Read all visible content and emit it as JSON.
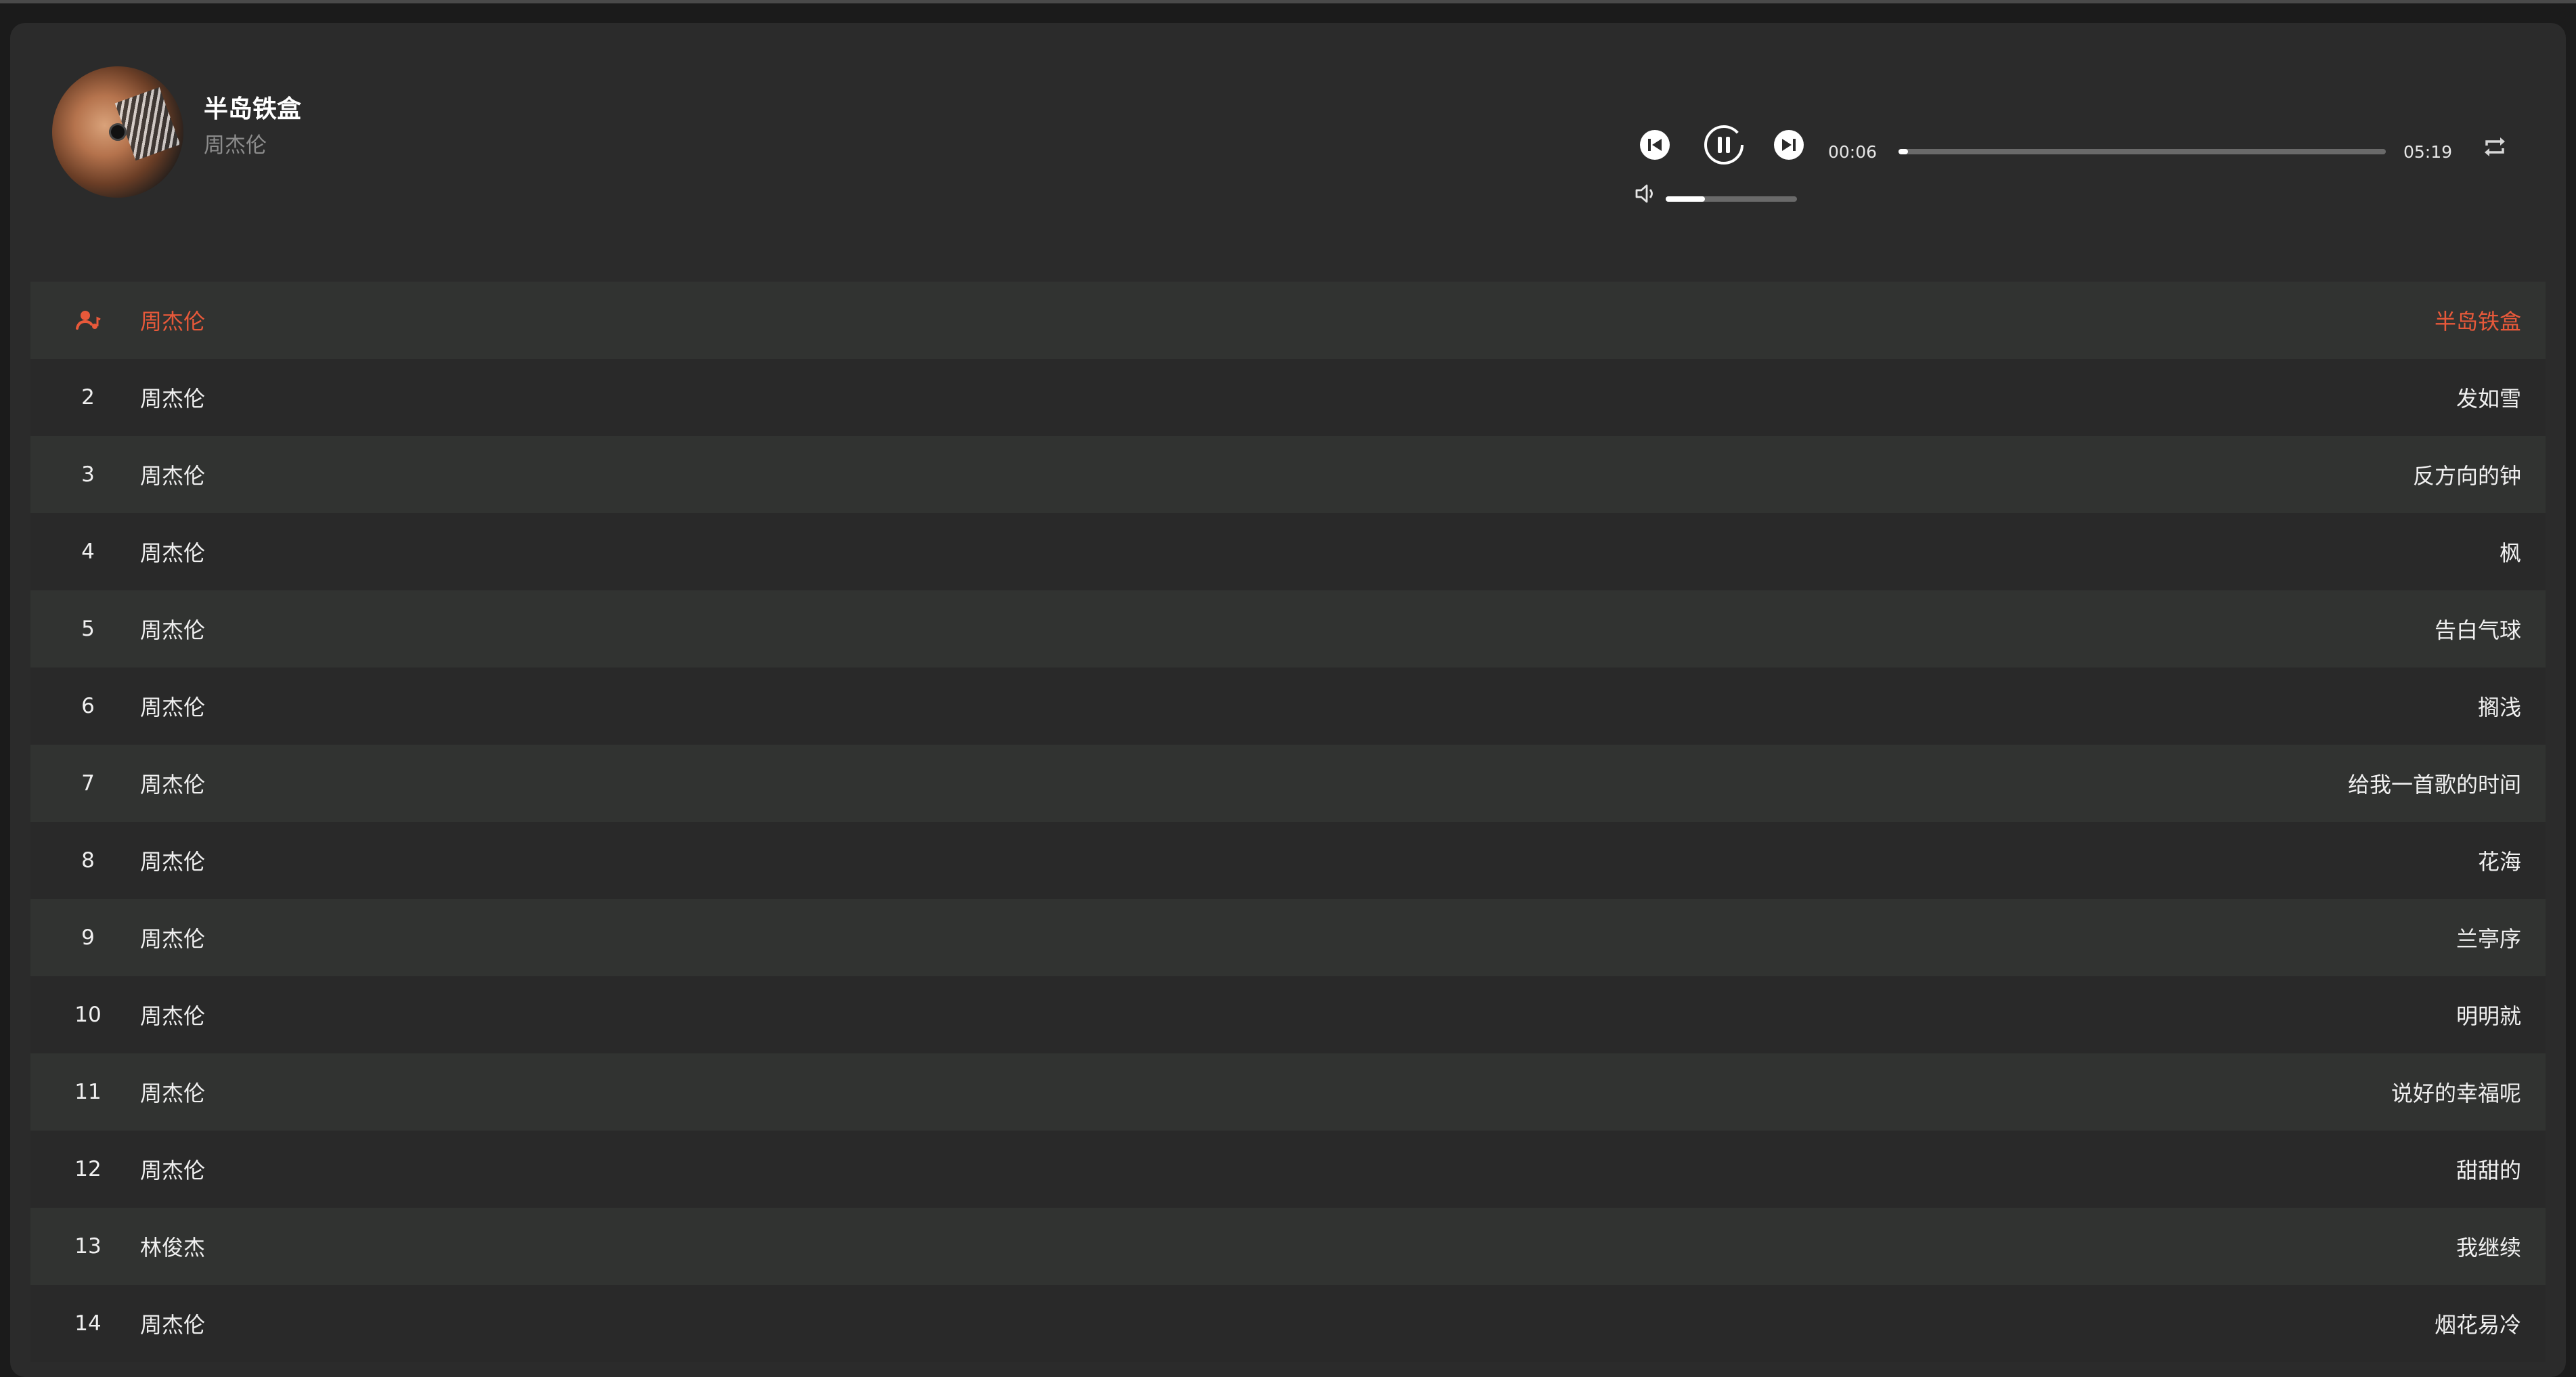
{
  "player": {
    "title": "半岛铁盒",
    "artist": "周杰伦",
    "current_time": "00:06",
    "total_time": "05:19",
    "progress_fraction": 0.019,
    "volume_fraction": 0.3,
    "state": "playing"
  },
  "icons": {
    "prev": "skip-previous-icon",
    "pause": "pause-icon",
    "next": "skip-next-icon",
    "repeat": "repeat-icon",
    "volume": "volume-icon",
    "now_playing": "now-playing-icon"
  },
  "colors": {
    "accent": "#e8593a",
    "background": "#2b2b2b",
    "row_alt": "#313331"
  },
  "playlist": [
    {
      "index": "",
      "artist": "周杰伦",
      "title": "半岛铁盒",
      "active": true
    },
    {
      "index": "2",
      "artist": "周杰伦",
      "title": "发如雪"
    },
    {
      "index": "3",
      "artist": "周杰伦",
      "title": "反方向的钟"
    },
    {
      "index": "4",
      "artist": "周杰伦",
      "title": "枫"
    },
    {
      "index": "5",
      "artist": "周杰伦",
      "title": "告白气球"
    },
    {
      "index": "6",
      "artist": "周杰伦",
      "title": "搁浅"
    },
    {
      "index": "7",
      "artist": "周杰伦",
      "title": "给我一首歌的时间"
    },
    {
      "index": "8",
      "artist": "周杰伦",
      "title": "花海"
    },
    {
      "index": "9",
      "artist": "周杰伦",
      "title": "兰亭序"
    },
    {
      "index": "10",
      "artist": "周杰伦",
      "title": "明明就"
    },
    {
      "index": "11",
      "artist": "周杰伦",
      "title": "说好的幸福呢"
    },
    {
      "index": "12",
      "artist": "周杰伦",
      "title": "甜甜的"
    },
    {
      "index": "13",
      "artist": "林俊杰",
      "title": "我继续"
    },
    {
      "index": "14",
      "artist": "周杰伦",
      "title": "烟花易冷"
    }
  ]
}
